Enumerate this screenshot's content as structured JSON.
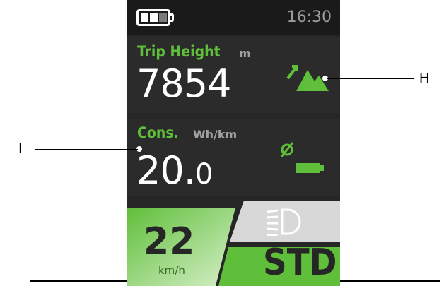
{
  "status": {
    "time": "16:30",
    "battery_level": 0.25
  },
  "trip_height": {
    "label": "Trip Height",
    "unit": "m",
    "value": "7854",
    "icon": "mountain-ascent-icon"
  },
  "consumption": {
    "label": "Cons.",
    "unit": "Wh/km",
    "value_int": "20.",
    "value_dec": "0",
    "icon": "average-battery-icon"
  },
  "speed": {
    "value": "22",
    "unit": "km/h"
  },
  "light": {
    "icon": "headlight-icon"
  },
  "mode": {
    "label": "STD"
  },
  "callouts": {
    "h": "H",
    "i": "I"
  },
  "colors": {
    "accent": "#5fbf3a",
    "panel": "#2b2b2b",
    "background": "#262626"
  }
}
